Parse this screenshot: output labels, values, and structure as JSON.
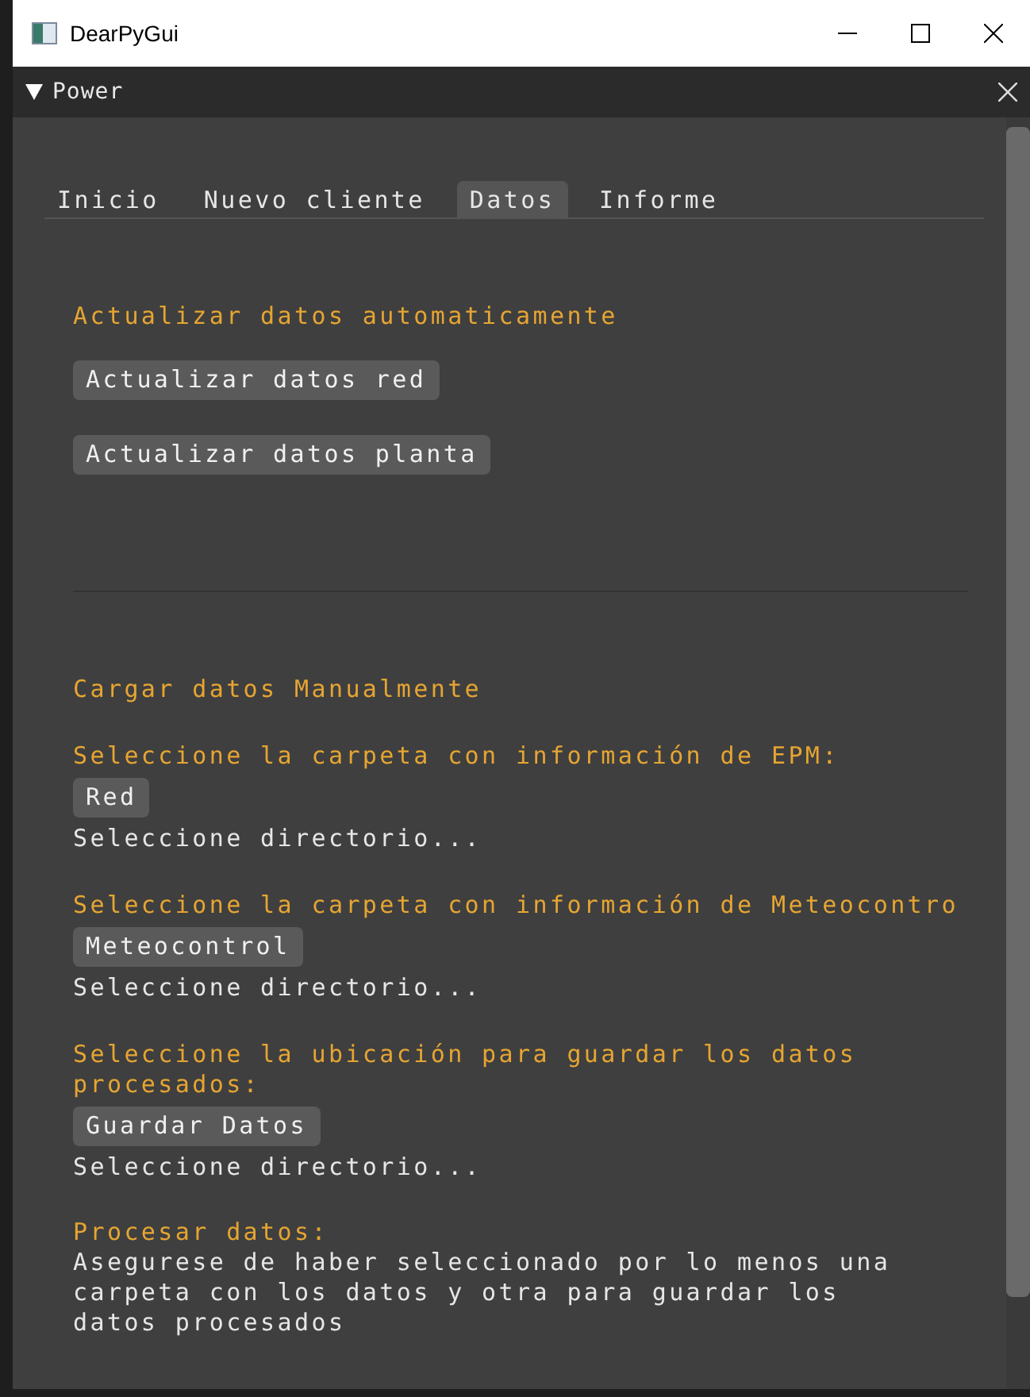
{
  "window": {
    "title": "DearPyGui"
  },
  "panel": {
    "title": "Power",
    "expanded": true
  },
  "tabs": [
    {
      "label": "Inicio",
      "selected": false
    },
    {
      "label": "Nuevo cliente",
      "selected": false
    },
    {
      "label": "Datos",
      "selected": true
    },
    {
      "label": "Informe",
      "selected": false
    }
  ],
  "auto_section": {
    "heading": "Actualizar datos automaticamente",
    "buttons": [
      "Actualizar datos red",
      "Actualizar datos planta"
    ]
  },
  "manual_section": {
    "heading": "Cargar datos Manualmente",
    "groups": [
      {
        "label": "Seleccione la carpeta con información de EPM:",
        "button": "Red",
        "path": "Seleccione directorio..."
      },
      {
        "label": "Seleccione la carpeta con información de Meteocontro",
        "button": "Meteocontrol",
        "path": "Seleccione directorio..."
      },
      {
        "label": "Seleccione la ubicación para guardar los datos procesados:",
        "button": "Guardar Datos",
        "path": "Seleccione directorio..."
      }
    ]
  },
  "process_section": {
    "heading": "Procesar datos:",
    "note": "Asegurese de haber seleccionado por lo menos una carpeta con los datos y otra para guardar los datos procesados"
  }
}
